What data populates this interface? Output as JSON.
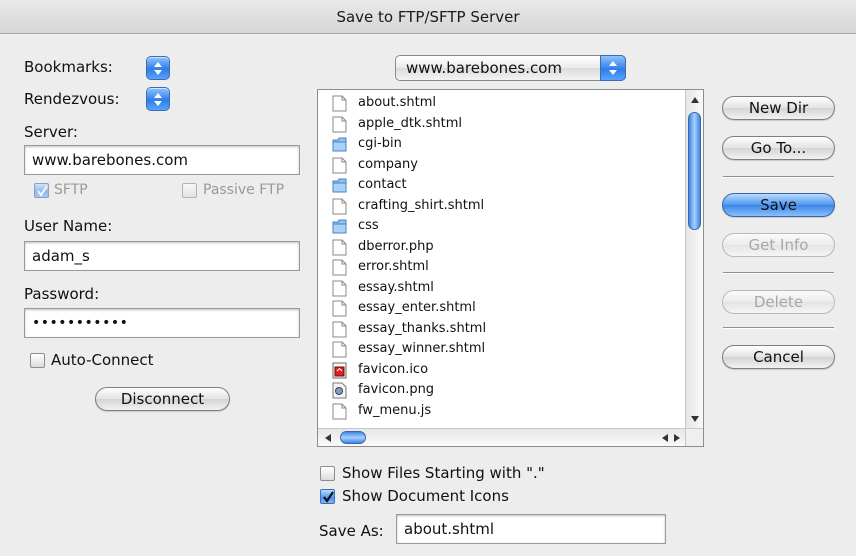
{
  "window": {
    "title": "Save to FTP/SFTP Server"
  },
  "left": {
    "bookmarks_label": "Bookmarks:",
    "rendezvous_label": "Rendezvous:",
    "server_label": "Server:",
    "server_value": "www.barebones.com",
    "sftp_label": "SFTP",
    "passive_label": "Passive FTP",
    "username_label": "User Name:",
    "username_value": "adam_s",
    "password_label": "Password:",
    "password_value": "•••••••••••",
    "autoconnect_label": "Auto-Connect",
    "disconnect_label": "Disconnect"
  },
  "location": {
    "selected": "www.barebones.com"
  },
  "files": [
    {
      "name": "about.shtml",
      "icon": "document-icon"
    },
    {
      "name": "apple_dtk.shtml",
      "icon": "document-icon"
    },
    {
      "name": "cgi-bin",
      "icon": "folder-icon"
    },
    {
      "name": "company",
      "icon": "document-icon"
    },
    {
      "name": "contact",
      "icon": "folder-icon"
    },
    {
      "name": "crafting_shirt.shtml",
      "icon": "document-icon"
    },
    {
      "name": "css",
      "icon": "folder-icon"
    },
    {
      "name": "dberror.php",
      "icon": "document-icon"
    },
    {
      "name": "error.shtml",
      "icon": "document-icon"
    },
    {
      "name": "essay.shtml",
      "icon": "document-icon"
    },
    {
      "name": "essay_enter.shtml",
      "icon": "document-icon"
    },
    {
      "name": "essay_thanks.shtml",
      "icon": "document-icon"
    },
    {
      "name": "essay_winner.shtml",
      "icon": "document-icon"
    },
    {
      "name": "favicon.ico",
      "icon": "ico-file-icon"
    },
    {
      "name": "favicon.png",
      "icon": "png-file-icon"
    },
    {
      "name": "fw_menu.js",
      "icon": "document-icon"
    }
  ],
  "options": {
    "show_dot_files_label": "Show Files Starting with \".\"",
    "show_doc_icons_label": "Show Document Icons",
    "save_as_label": "Save As:",
    "save_as_value": "about.shtml"
  },
  "buttons": {
    "new_dir": "New Dir",
    "go_to": "Go To...",
    "save": "Save",
    "get_info": "Get Info",
    "delete": "Delete",
    "cancel": "Cancel"
  },
  "colors": {
    "accent": "#3b86e6"
  }
}
